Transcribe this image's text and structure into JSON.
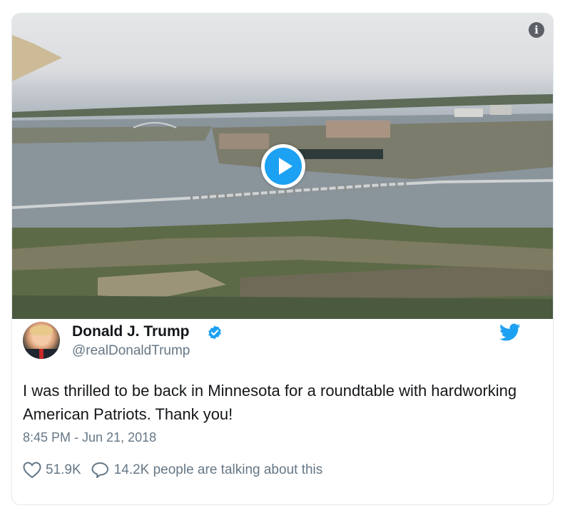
{
  "media": {
    "info_icon": "info-icon",
    "play_icon": "play-icon"
  },
  "author": {
    "display_name": "Donald J. Trump",
    "handle": "@realDonaldTrump",
    "verified_icon": "verified-badge-icon"
  },
  "brand": {
    "icon": "twitter-bird-icon",
    "accent_color": "#1da1f2"
  },
  "tweet": {
    "text": "I was thrilled to be back in Minnesota for a roundtable with hardworking American Patriots. Thank you!",
    "timestamp": "8:45 PM - Jun 21, 2018"
  },
  "actions": {
    "like_count": "51.9K",
    "talking_text": "14.2K people are talking about this"
  }
}
